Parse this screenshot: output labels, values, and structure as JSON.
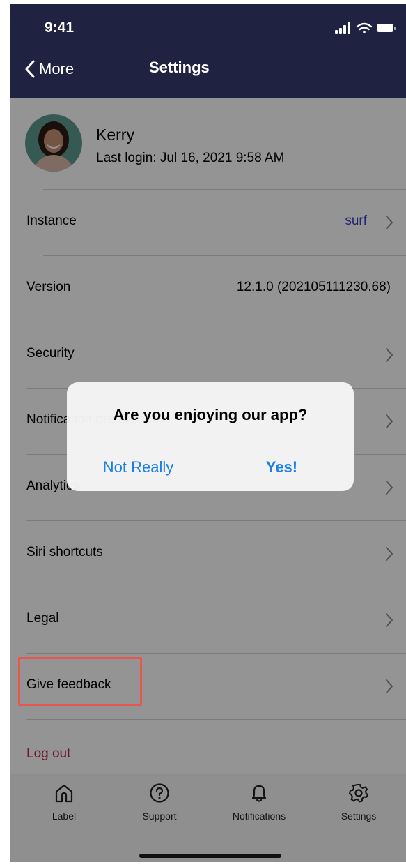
{
  "status_bar": {
    "time": "9:41"
  },
  "nav": {
    "back_label": "More",
    "title": "Settings"
  },
  "profile": {
    "name": "Kerry",
    "last_login": "Last login: Jul 16, 2021 9:58 AM"
  },
  "rows": [
    {
      "label": "Instance",
      "value": "surf"
    },
    {
      "label": "Version",
      "value": "12.1.0 (202105111230.68)"
    },
    {
      "label": "Security"
    },
    {
      "label": "Notification preferences"
    },
    {
      "label": "Analytics"
    },
    {
      "label": "Siri shortcuts"
    },
    {
      "label": "Legal"
    },
    {
      "label": "Give feedback"
    }
  ],
  "logout": {
    "label": "Log out",
    "color": "#c2244a"
  },
  "tabs": [
    {
      "label": "Label",
      "icon": "home-icon"
    },
    {
      "label": "Support",
      "icon": "question-circle-icon"
    },
    {
      "label": "Notifications",
      "icon": "bell-icon"
    },
    {
      "label": "Settings",
      "icon": "gear-icon"
    }
  ],
  "dialog": {
    "title": "Are you enjoying our app?",
    "secondary_button": "Not Really",
    "primary_button": "Yes!",
    "button_color": "#1a7fe6"
  },
  "colors": {
    "nav_background": "#1f2240",
    "accent_value": "#3b3fc4",
    "highlight": "#e8564f"
  }
}
